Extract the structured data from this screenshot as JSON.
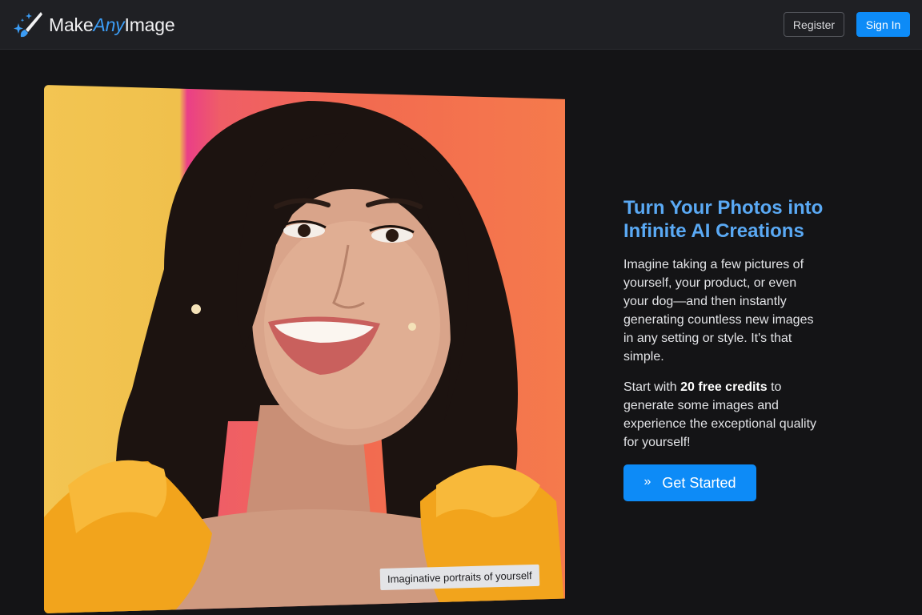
{
  "navbar": {
    "brand_prefix": "Make",
    "brand_accent": "Any",
    "brand_suffix": "Image",
    "brand_icon": "magic-wand-sparkle-icon",
    "register_label": "Register",
    "signin_label": "Sign In"
  },
  "hero": {
    "photo_caption": "Imaginative portraits of yourself",
    "title": "Turn Your Photos into Infinite AI Creations",
    "paragraph1": "Imagine taking a few pictures of yourself, your product, or even your dog—and then instantly generating countless new images in any setting or style. It's that simple.",
    "paragraph2_before": "Start with ",
    "paragraph2_bold": "20 free credits",
    "paragraph2_after": " to generate some images and experience the exceptional quality for yourself!",
    "cta_label": "Get Started",
    "cta_icon": "double-chevron-right-icon"
  },
  "colors": {
    "background": "#141416",
    "navbar": "#1f2024",
    "accent_blue": "#0d8bf7",
    "title_blue": "#5aa9f4"
  }
}
